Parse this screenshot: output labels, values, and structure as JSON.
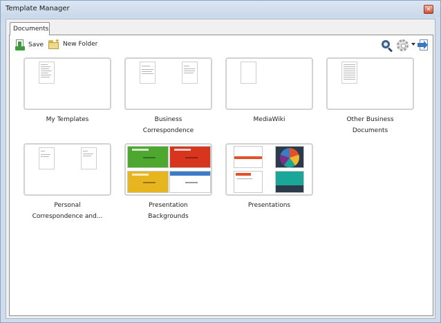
{
  "window": {
    "title": "Template Manager"
  },
  "tabs": [
    {
      "label": "Documents"
    }
  ],
  "toolbar": {
    "save_label": "Save",
    "new_folder_label": "New Folder",
    "search_icon": "search-icon",
    "settings_icon": "gear-icon",
    "import_icon": "import-icon"
  },
  "folders": [
    {
      "line1": "My Templates",
      "line2": ""
    },
    {
      "line1": "Business",
      "line2": "Correspondence"
    },
    {
      "line1": "MediaWiki",
      "line2": ""
    },
    {
      "line1": "Other Business",
      "line2": "Documents"
    },
    {
      "line1": "Personal",
      "line2": "Correspondence and..."
    },
    {
      "line1": "Presentation",
      "line2": "Backgrounds"
    },
    {
      "line1": "Presentations",
      "line2": ""
    }
  ],
  "colors": {
    "green_bg": "#4ea72e",
    "red_bg": "#d8351f",
    "yellow_bg": "#e7b51f",
    "blue_accent": "#3e7bc7",
    "teal": "#1aa79a",
    "dark_slate": "#2c3b4c"
  }
}
